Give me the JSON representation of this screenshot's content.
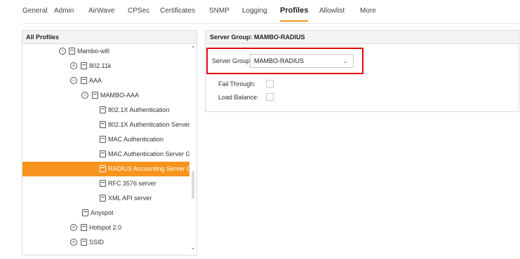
{
  "top_nav": {
    "tabs": [
      "General",
      "Admin",
      "AirWave",
      "CPSec",
      "Certificates",
      "SNMP",
      "Logging",
      "Profiles",
      "Allowlist",
      "More"
    ],
    "active_tab": "Profiles"
  },
  "left_panel": {
    "title": "All Profiles",
    "tree": [
      {
        "label": "Mambo-wifi",
        "toggle": "−",
        "icon": "document-icon"
      },
      {
        "label": "802.11k",
        "toggle": "+",
        "icon": "document-icon"
      },
      {
        "label": "AAA",
        "toggle": "−",
        "icon": "document-icon"
      },
      {
        "label": "MAMBO-AAA",
        "toggle": "−",
        "icon": "document-icon"
      },
      {
        "label": "802.1X Authentication",
        "icon": "document-icon"
      },
      {
        "label": "802.1X Authentication Server",
        "icon": "document-icon"
      },
      {
        "label": "MAC Authentication",
        "icon": "document-icon"
      },
      {
        "label": "MAC Authentication Server Gr",
        "icon": "document-icon"
      },
      {
        "label": "RADIUS Accounting Server Gr",
        "icon": "document-icon",
        "selected": true
      },
      {
        "label": "RFC 3576 server",
        "icon": "document-icon"
      },
      {
        "label": "XML API server",
        "icon": "document-icon"
      },
      {
        "label": "Anyspot",
        "icon": "document-icon"
      },
      {
        "label": "Hotspot 2.0",
        "toggle": "+",
        "icon": "document-icon"
      },
      {
        "label": "SSID",
        "toggle": "+",
        "icon": "document-icon"
      }
    ]
  },
  "right_panel": {
    "title": "Server Group: MAMBO-RADIUS",
    "server_group_label": "Server Group:",
    "server_group_value": "MAMBO-RADIUS",
    "fail_through_label": "Fail Through:",
    "fail_through_checked": false,
    "load_balance_label": "Load Balance:",
    "load_balance_checked": false
  },
  "colors": {
    "accent": "#f7941d",
    "highlight_box": "#e30613",
    "chevron": "#2a7ec7"
  }
}
